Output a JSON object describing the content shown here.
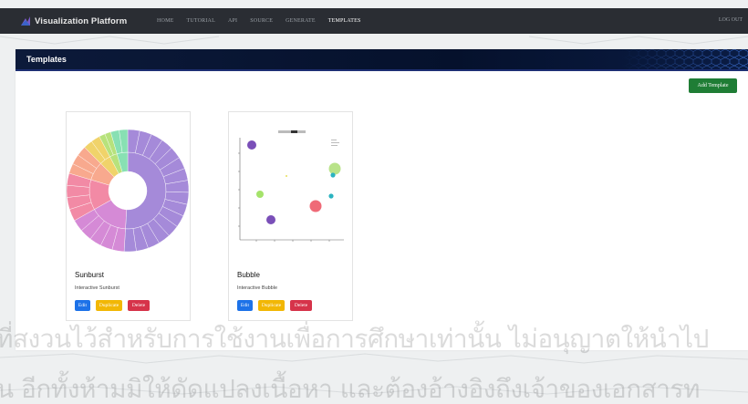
{
  "navbar": {
    "brand": "Visualization Platform",
    "links": [
      "HOME",
      "TUTORIAL",
      "API",
      "SOURCE",
      "GENERATE",
      "TEMPLATES"
    ],
    "active_index": 5,
    "logout": "LOG OUT"
  },
  "panel": {
    "title": "Templates",
    "add_button": "Add Template"
  },
  "cards": [
    {
      "title": "Sunburst",
      "description": "Interactive Sunburst",
      "buttons": {
        "edit": "Edit",
        "duplicate": "Duplicate",
        "delete": "Delete"
      }
    },
    {
      "title": "Bubble",
      "description": "Interactive Bubble",
      "buttons": {
        "edit": "Edit",
        "duplicate": "Duplicate",
        "delete": "Delete"
      }
    }
  ],
  "watermark": {
    "line1": "ที่สงวนไว้สำหรับการใช้งานเพื่อการศึกษาเท่านั้น ไม่อนุญาตให้นำไป",
    "line2": "น อีกทั้งห้ามมิให้ดัดแปลงเนื้อหา และต้องอ้างอิงถึงเจ้าของเอกสารท"
  },
  "colors": {
    "navbar": "#2a2d33",
    "panel_header": "#05112c",
    "add_button": "#1f7d35",
    "edit": "#1d72e8",
    "duplicate": "#f2b705",
    "delete": "#d6334a"
  }
}
